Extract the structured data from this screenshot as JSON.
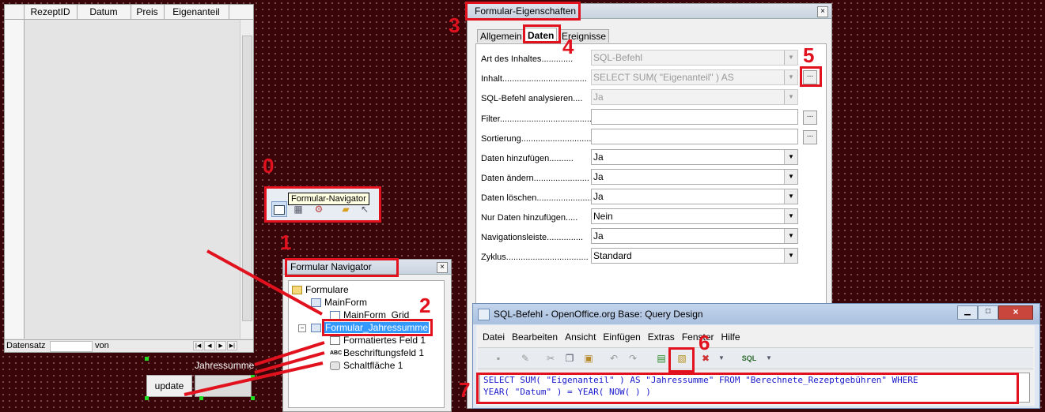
{
  "grid": {
    "columns": [
      "RezeptID",
      "Datum",
      "Preis",
      "Eigenanteil"
    ],
    "record_label": "Datensatz",
    "of_label": "von"
  },
  "form_controls": {
    "label": "Jahressumme",
    "button": "update"
  },
  "tooltip": "Formular-Navigator",
  "navigator": {
    "title": "Formular Navigator",
    "items": [
      "Formulare",
      "MainForm",
      "MainForm_Grid",
      "Formular_Jahressumme",
      "Formatiertes Feld 1",
      "Beschriftungsfeld 1",
      "Schaltfläche 1"
    ],
    "abc_icon": "ABC"
  },
  "props": {
    "title": "Formular-Eigenschaften",
    "tabs": [
      "Allgemein",
      "Daten",
      "Ereignisse"
    ],
    "rows": [
      {
        "label": "Art des Inhaltes",
        "value": "SQL-Befehl"
      },
      {
        "label": "Inhalt",
        "value": "SELECT SUM( \"Eigenanteil\" ) AS"
      },
      {
        "label": "SQL-Befehl analysieren",
        "value": "Ja"
      },
      {
        "label": "Filter",
        "value": ""
      },
      {
        "label": "Sortierung",
        "value": ""
      },
      {
        "label": "Daten hinzufügen",
        "value": "Ja"
      },
      {
        "label": "Daten ändern",
        "value": "Ja"
      },
      {
        "label": "Daten löschen",
        "value": "Ja"
      },
      {
        "label": "Nur Daten hinzufügen",
        "value": "Nein"
      },
      {
        "label": "Navigationsleiste",
        "value": "Ja"
      },
      {
        "label": "Zyklus",
        "value": "Standard"
      }
    ],
    "ellipsis": "..."
  },
  "sql": {
    "title": "SQL-Befehl - OpenOffice.org Base: Query Design",
    "menu": [
      "Datei",
      "Bearbeiten",
      "Ansicht",
      "Einfügen",
      "Extras",
      "Fenster",
      "Hilfe"
    ],
    "sql_icon": "SQL",
    "query_line1": "SELECT SUM( \"Eigenanteil\" ) AS \"Jahressumme\" FROM \"Berechnete_Rezeptgebühren\" WHERE",
    "query_line2": "YEAR( \"Datum\" ) = YEAR( NOW( ) )"
  },
  "markers": [
    "0",
    "1",
    "2",
    "3",
    "4",
    "5",
    "6",
    "7"
  ],
  "colors": {
    "highlight": "#e1121e",
    "selection": "#3399ff",
    "background": "#3a0509"
  }
}
